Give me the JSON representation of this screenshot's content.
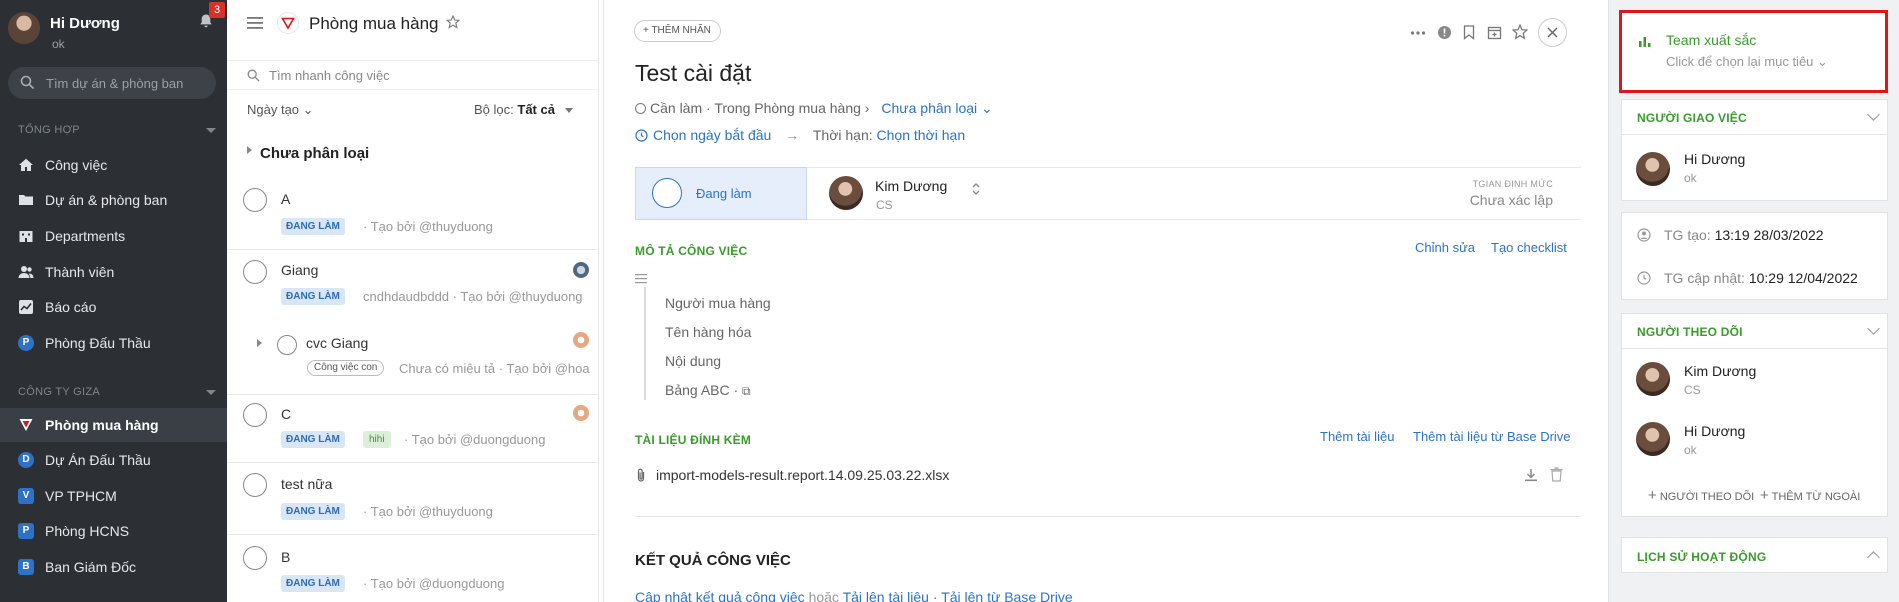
{
  "sidebar": {
    "user_name": "Hi Dương",
    "user_status": "ok",
    "notif_count": "3",
    "search_placeholder": "Tìm dự án & phòng ban",
    "section1": "TỔNG HỢP",
    "section2": "CÔNG TY GIZA",
    "items": [
      {
        "label": "Công việc",
        "icon": "home-icon"
      },
      {
        "label": "Dự án & phòng ban",
        "icon": "folder-icon"
      },
      {
        "label": "Departments",
        "icon": "building-icon"
      },
      {
        "label": "Thành viên",
        "icon": "users-icon"
      },
      {
        "label": "Báo cáo",
        "icon": "chart-icon"
      },
      {
        "label": "Phòng Đấu Thầu",
        "icon": "P",
        "color": "#2d72c8"
      }
    ],
    "company_items": [
      {
        "label": "Phòng mua hàng",
        "icon": "triangle-icon",
        "active": true
      },
      {
        "label": "Dự Án Đấu Thầu",
        "icon": "D",
        "color": "#2d72c8"
      },
      {
        "label": "VP TPHCM",
        "icon": "V",
        "color": "#2d72c8"
      },
      {
        "label": "Phòng HCNS",
        "icon": "P",
        "color": "#2d72c8"
      },
      {
        "label": "Ban Giám Đốc",
        "icon": "B",
        "color": "#2d72c8"
      }
    ]
  },
  "list": {
    "title": "Phòng mua hàng",
    "search_placeholder": "Tìm nhanh công việc",
    "sort_label": "Ngày tạo",
    "filter_label": "Bộ lọc:",
    "filter_value": "Tất cả",
    "group_title": "Chưa phân loại",
    "tasks": [
      {
        "title": "A",
        "status": "ĐANG LÀM",
        "meta": "· Tạo bởi @thuyduong"
      },
      {
        "title": "Giang",
        "status": "ĐANG LÀM",
        "meta": "cndhdaudbddd · Tạo bởi @thuyduong"
      },
      {
        "title": "cvc Giang",
        "tag": "Công việc con",
        "meta": "Chưa có miêu tả · Tạo bởi @hoa"
      },
      {
        "title": "C",
        "status": "ĐANG LÀM",
        "tag": "hihi",
        "meta": "· Tạo bởi @duongduong"
      },
      {
        "title": "test nữa",
        "status": "ĐANG LÀM",
        "meta": "· Tạo bởi @thuyduong"
      },
      {
        "title": "B",
        "status": "ĐANG LÀM",
        "meta": "· Tạo bởi @duongduong"
      }
    ]
  },
  "detail": {
    "add_tag": "+ THÊM NHÃN",
    "title": "Test cài đặt",
    "breadcrumb": "Cần làm · Trong Phòng mua hàng ›",
    "category": "Chưa phân loại",
    "start_date": "Chọn ngày bắt đầu",
    "deadline_label": "Thời hạn:",
    "deadline_value": "Chọn thời hạn",
    "status": "Đang làm",
    "assignee_name": "Kim Dương",
    "assignee_role": "CS",
    "norm_label": "TGIAN ĐỊNH MỨC",
    "norm_value": "Chưa xác lập",
    "desc_title": "MÔ TẢ CÔNG VIỆC",
    "edit": "Chỉnh sửa",
    "create_checklist": "Tạo checklist",
    "desc_lines": [
      "Người mua hàng",
      "Tên hàng hóa",
      "Nội dung",
      "Bảng ABC ·"
    ],
    "attach_title": "TÀI LIỆU ĐÍNH KÈM",
    "add_file": "Thêm tài liệu",
    "add_drive": "Thêm tài liệu từ Base Drive",
    "file_name": "import-models-result.report.14.09.25.03.22.xlsx",
    "result_title": "KẾT QUẢ CÔNG VIỆC",
    "result_update": "Cập nhật kết quả công việc",
    "result_or": "hoặc",
    "result_upload": "Tải lên tài liệu",
    "result_sep": "·",
    "result_drive": "Tải lên từ Base Drive"
  },
  "right": {
    "goal_title": "Team xuất sắc",
    "goal_sub": "Click để chọn lại mục tiêu",
    "assigner_title": "NGƯỜI GIAO VIỆC",
    "assigner_name": "Hi Dương",
    "assigner_sub": "ok",
    "created_label": "TG tạo:",
    "created_value": "13:19 28/03/2022",
    "updated_label": "TG cập nhật:",
    "updated_value": "10:29 12/04/2022",
    "followers_title": "NGƯỜI THEO DÕI",
    "followers": [
      {
        "name": "Kim Dương",
        "sub": "CS"
      },
      {
        "name": "Hi Dương",
        "sub": "ok"
      }
    ],
    "add_follower": "NGƯỜI THEO DÕI",
    "add_external": "THÊM TỪ NGOÀI",
    "history_title": "LỊCH SỬ HOẠT ĐỘNG"
  },
  "colors": {
    "sidebar_bg": "#2c3035",
    "accent_green": "#3a9a2c",
    "link_blue": "#2d72c8",
    "highlight_red": "#e0141a",
    "badge_red": "#d9302a"
  }
}
